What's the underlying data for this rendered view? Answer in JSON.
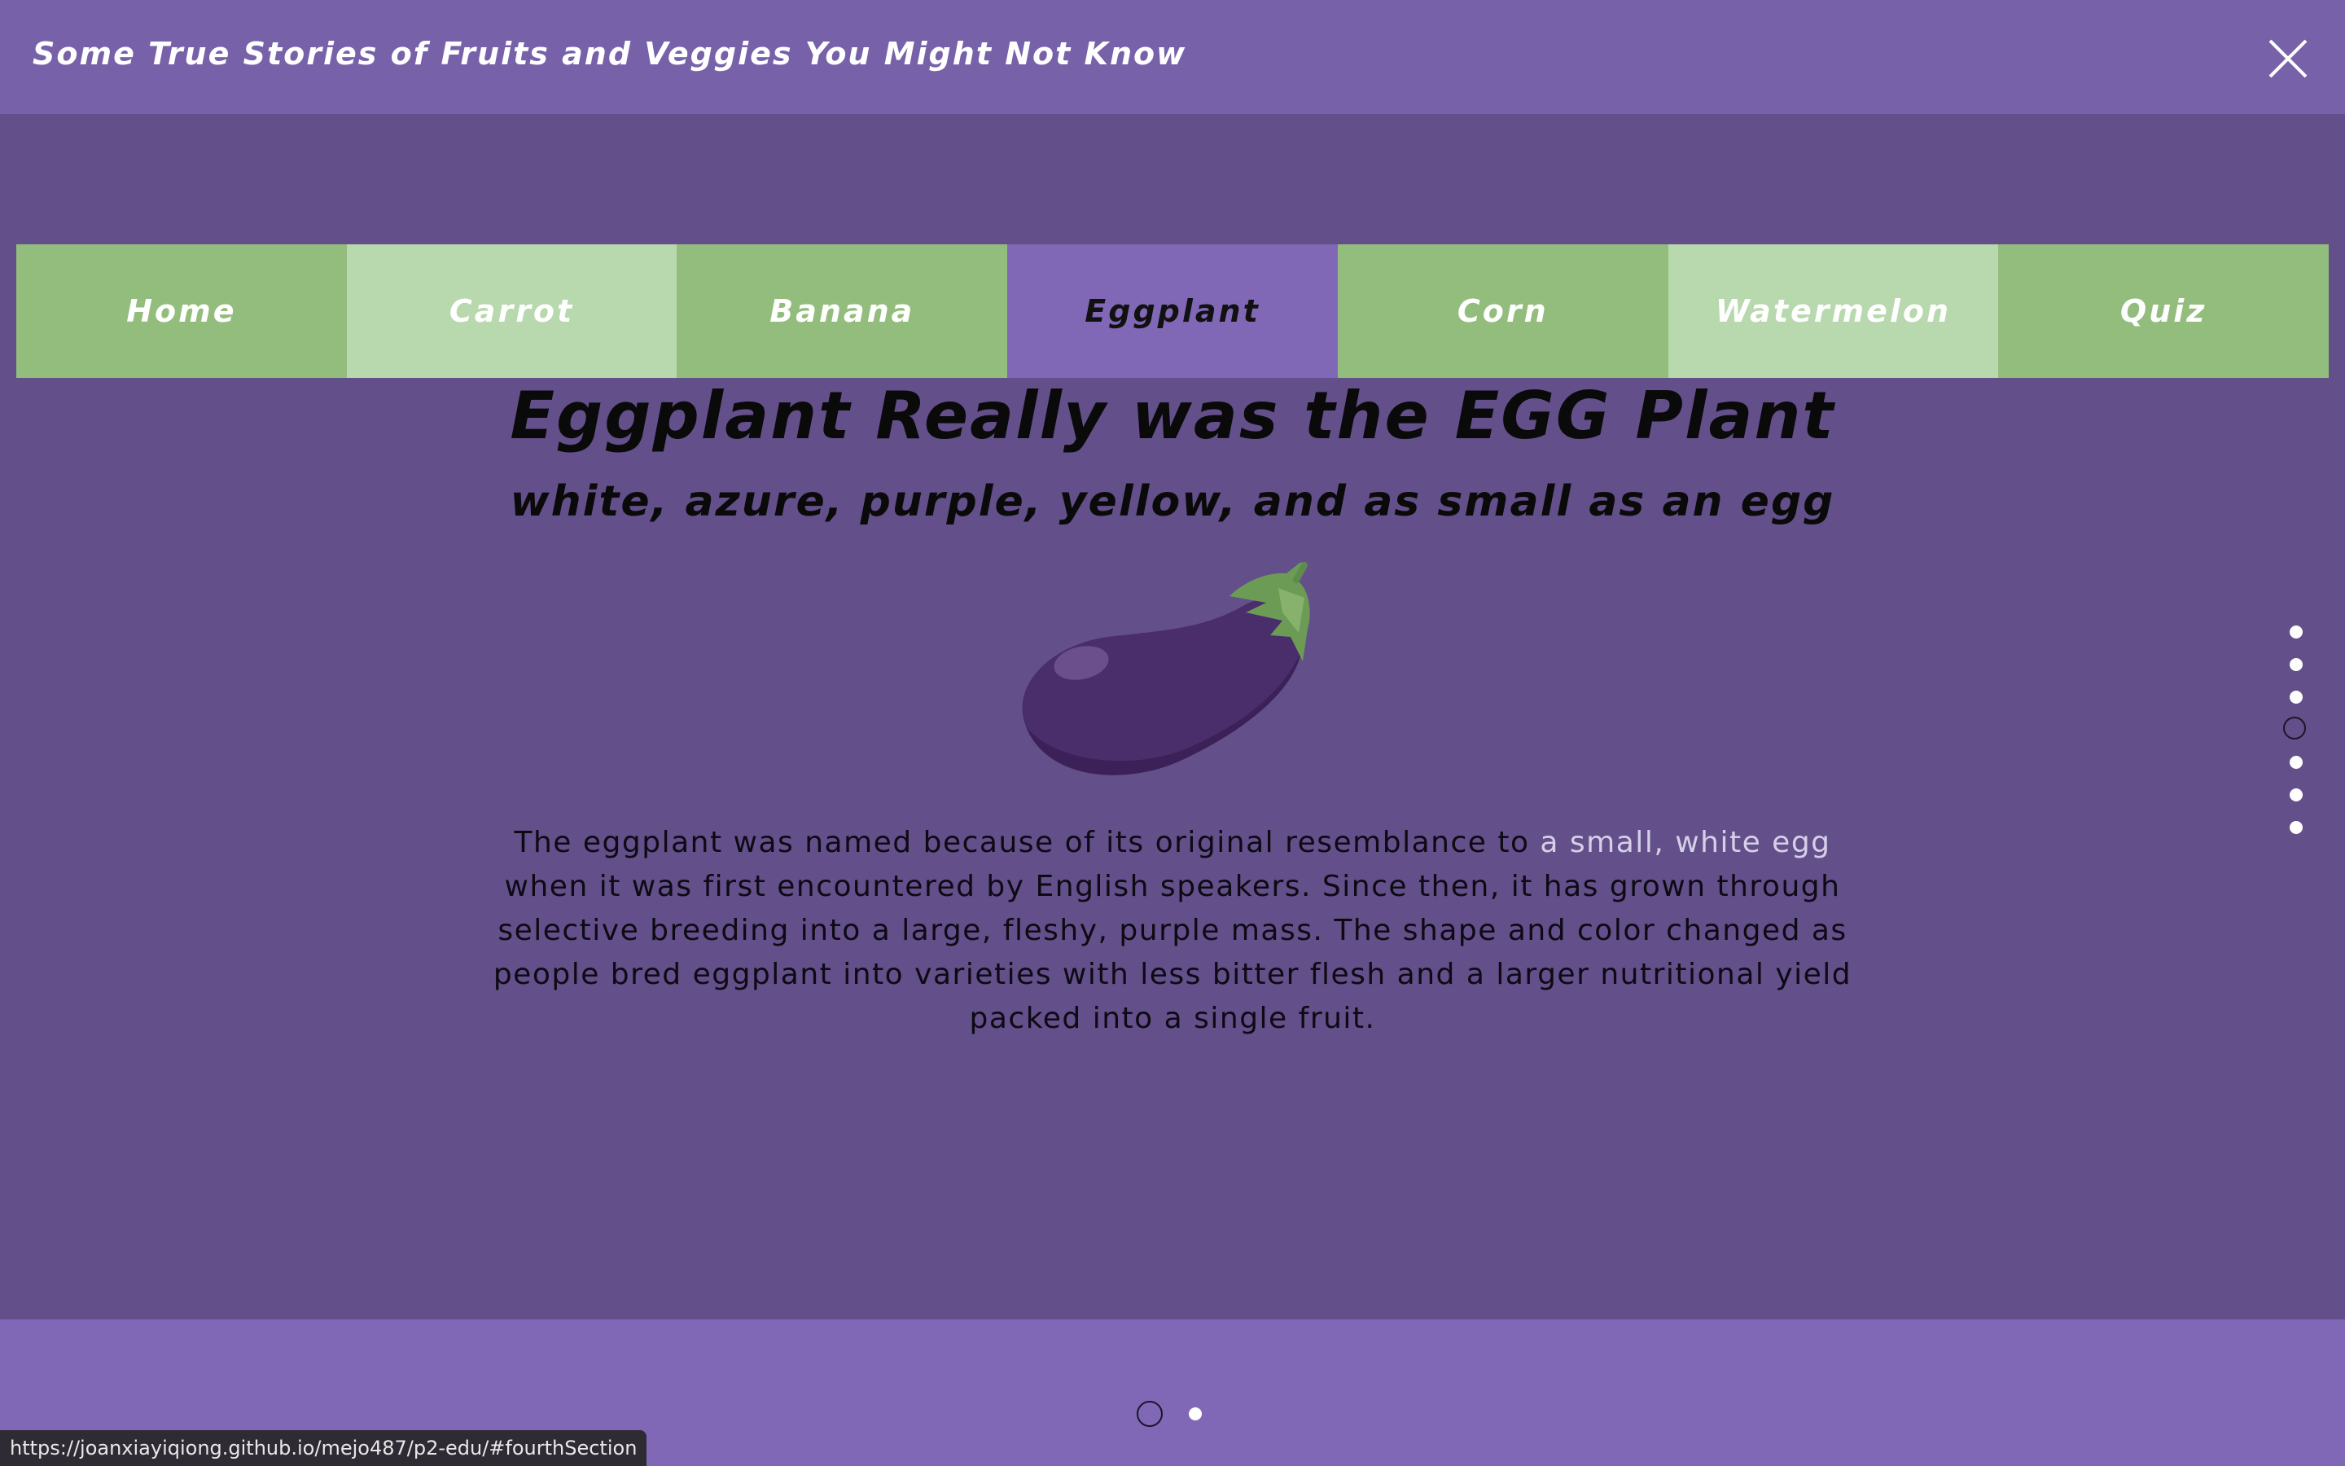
{
  "header": {
    "title": "Some True Stories of Fruits and Veggies You Might Not Know",
    "close_icon": "close-icon"
  },
  "nav": {
    "items": [
      {
        "label": "Home"
      },
      {
        "label": "Carrot"
      },
      {
        "label": "Banana"
      },
      {
        "label": "Eggplant"
      },
      {
        "label": "Corn"
      },
      {
        "label": "Watermelon"
      },
      {
        "label": "Quiz"
      }
    ],
    "active_index": 3
  },
  "section": {
    "heading": "Eggplant Really was the EGG Plant",
    "subheading": "white, azure, purple, yellow, and as small as an egg",
    "image_icon": "eggplant-icon",
    "body_before": "The eggplant was named because of its original resemblance to ",
    "body_highlight": "a small, white egg",
    "body_after": " when it was first encountered by English speakers. Since then, it has grown through selective breeding into a large, fleshy, purple mass. The shape and color changed as people bred eggplant into varieties with less bitter flesh and a larger nutritional yield packed into a single fruit."
  },
  "side_nav": {
    "count": 7,
    "active_index": 3
  },
  "slides": {
    "count": 2,
    "active_index": 0
  },
  "status_bar": {
    "url": "https://joanxiayiqiong.github.io/mejo487/p2-edu/#fourthSection"
  },
  "colors": {
    "background": "#634f89",
    "topbar": "#7762a9",
    "nav_dark": "#93bd7d",
    "nav_light": "#b8d8ad",
    "nav_active": "#8168b6",
    "footer": "#8168b6"
  }
}
